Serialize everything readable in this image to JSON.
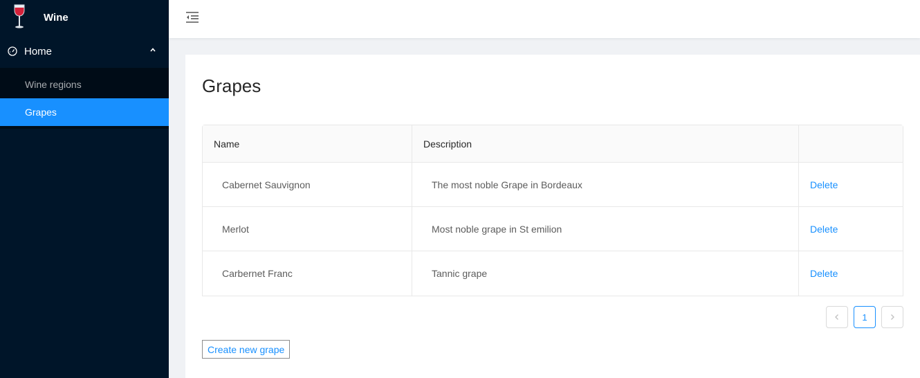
{
  "app": {
    "title": "Wine"
  },
  "sidebar": {
    "group_label": "Home",
    "items": [
      {
        "label": "Wine regions"
      },
      {
        "label": "Grapes"
      }
    ]
  },
  "page": {
    "title": "Grapes"
  },
  "table": {
    "columns": [
      "Name",
      "Description",
      ""
    ],
    "rows": [
      {
        "name": "Cabernet Sauvignon",
        "description": "The most noble Grape in Bordeaux",
        "action": "Delete"
      },
      {
        "name": "Merlot",
        "description": "Most noble grape in St emilion",
        "action": "Delete"
      },
      {
        "name": "Carbernet Franc",
        "description": "Tannic grape",
        "action": "Delete"
      }
    ]
  },
  "pagination": {
    "current_page": "1"
  },
  "actions": {
    "create_label": "Create new grape"
  },
  "colors": {
    "sider": "#001529",
    "accent": "#1890ff",
    "submenu_bg": "#000c17"
  }
}
